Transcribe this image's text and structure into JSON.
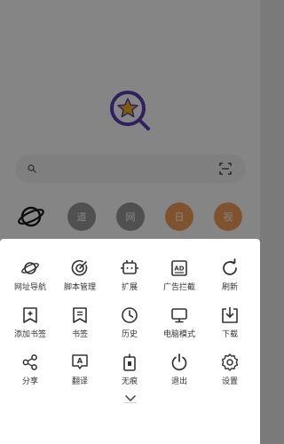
{
  "colors": {
    "accent_purple": "#5b3fb8",
    "accent_yellow": "#f2b400",
    "shortcut_gray": "#9a9a9a",
    "shortcut_orange": "#f6a05a",
    "icon_dark": "#333333"
  },
  "background": {
    "logo_icon": "star-magnifier-logo",
    "search": {
      "placeholder": "",
      "left_icon": "search-icon",
      "right_icon": "scan-icon"
    },
    "shortcuts": [
      {
        "icon": "planet-icon",
        "label": ""
      },
      {
        "icon": "",
        "label": "道"
      },
      {
        "icon": "",
        "label": "网"
      },
      {
        "icon": "",
        "label": "日"
      },
      {
        "icon": "",
        "label": "视"
      }
    ]
  },
  "menu": {
    "rows": [
      [
        {
          "icon": "planet-icon",
          "label": "网址导航"
        },
        {
          "icon": "target-icon",
          "label": "脚本管理"
        },
        {
          "icon": "plugin-icon",
          "label": "扩展"
        },
        {
          "icon": "ad-block-icon",
          "label": "广告拦截"
        },
        {
          "icon": "refresh-icon",
          "label": "刷新"
        }
      ],
      [
        {
          "icon": "add-bookmark-icon",
          "label": "添加书签"
        },
        {
          "icon": "bookmark-icon",
          "label": "书签"
        },
        {
          "icon": "clock-icon",
          "label": "历史"
        },
        {
          "icon": "monitor-icon",
          "label": "电脑模式"
        },
        {
          "icon": "download-icon",
          "label": "下载"
        }
      ],
      [
        {
          "icon": "share-icon",
          "label": "分享"
        },
        {
          "icon": "translate-icon",
          "label": "翻译"
        },
        {
          "icon": "incognito-icon",
          "label": "无痕"
        },
        {
          "icon": "power-icon",
          "label": "退出"
        },
        {
          "icon": "gear-icon",
          "label": "设置"
        }
      ]
    ],
    "collapse_icon": "chevron-down-icon"
  }
}
